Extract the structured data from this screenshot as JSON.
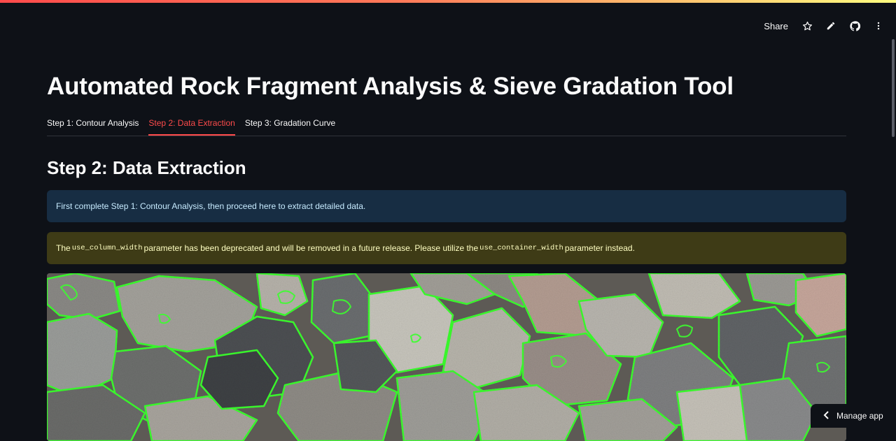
{
  "header": {
    "share_label": "Share",
    "icons": [
      "star-icon",
      "pencil-icon",
      "github-icon",
      "more-vertical-icon"
    ]
  },
  "app": {
    "title": "Automated Rock Fragment Analysis & Sieve Gradation Tool",
    "tabs": [
      {
        "label": "Step 1: Contour Analysis",
        "active": false
      },
      {
        "label": "Step 2: Data Extraction",
        "active": true
      },
      {
        "label": "Step 3: Gradation Curve",
        "active": false
      }
    ]
  },
  "section": {
    "title": "Step 2: Data Extraction",
    "info_message": "First complete Step 1: Contour Analysis, then proceed here to extract detailed data.",
    "warning": {
      "part1": "The ",
      "code1": "use_column_width",
      "part2": " parameter has been deprecated and will be removed in a future release. Please utilize the ",
      "code2": "use_container_width",
      "part3": " parameter instead."
    }
  },
  "image": {
    "content": "rock fragments with green contour outlines",
    "contour_color": "#33ff33"
  },
  "footer": {
    "manage_app_label": "Manage app"
  },
  "colors": {
    "background": "#0e1117",
    "accent": "#ff4b4b",
    "info_bg": "#172d43",
    "warning_bg": "#3e3b16"
  }
}
